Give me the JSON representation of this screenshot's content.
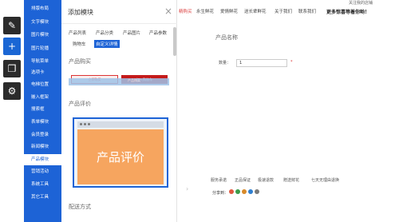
{
  "toolbar": {
    "tools": [
      {
        "name": "edit-icon",
        "glyph": "✎"
      },
      {
        "name": "add-icon",
        "glyph": "+"
      },
      {
        "name": "pages-icon",
        "glyph": "❐"
      },
      {
        "name": "gear-icon",
        "glyph": "⚙"
      }
    ]
  },
  "modnav": {
    "items": [
      "排版布局",
      "文字模块",
      "图片模块",
      "图片轮播",
      "导航菜单",
      "选项卡",
      "电梯位置",
      "嵌入框架",
      "搜索框",
      "表单模块",
      "会员登录",
      "新闻模块",
      "产品模块",
      "营销活动",
      "系统工具",
      "其它工具"
    ],
    "selected_index": 12
  },
  "panel": {
    "title": "添加模块",
    "close": "×",
    "tabs": [
      "产品列表",
      "产品分类",
      "产品图片",
      "产品参数",
      "购物车",
      "自定义详情"
    ],
    "selected_tab": "自定义详情",
    "sections": {
      "buy": "产品购买",
      "eval": "产品评价",
      "shipping": "配送方式"
    },
    "buy_preview": {
      "btn_a": "立即购买",
      "btn_b": "加入购物车",
      "highlight": "产品购买"
    },
    "eval_preview": {
      "text": "产品评价"
    }
  },
  "site": {
    "nav": [
      "精购买",
      "永生鲜花",
      "爱情鲜花",
      "送长辈鲜花",
      "关于我们",
      "联系我们"
    ],
    "top_right": "关注我的店铺",
    "slogan": "更多惊喜等着你哟！",
    "product_name": "产品名称",
    "qty_label": "数量：",
    "qty_value": "1",
    "qty_star": "*",
    "footer_links": [
      "服务承诺",
      "正品保证",
      "极速退款",
      "赠送鲜花",
      "七天无理由退换"
    ],
    "share_label": "分享到："
  },
  "colors": {
    "accent": "#1d63d6",
    "toolbar": "#2b2b2b",
    "nav_red": "#d44444",
    "eval_orange": "#f6a55f"
  }
}
